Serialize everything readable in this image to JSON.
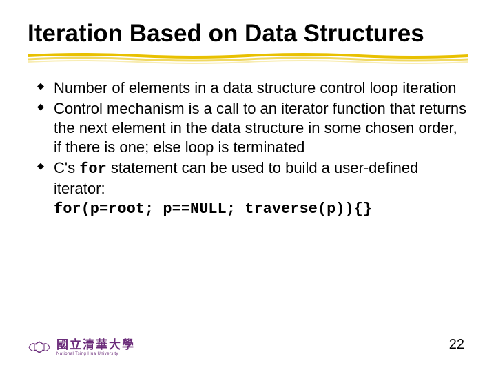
{
  "slide": {
    "title": "Iteration Based on Data Structures",
    "bullets": [
      {
        "text": "Number of elements in a data structure control loop iteration"
      },
      {
        "text": "Control mechanism is a call to an iterator function that returns the next element in the data structure in some chosen order, if there is one; else loop is terminated"
      },
      {
        "pre": "C's ",
        "code_inline": "for",
        "post": " statement can be used to build a user-defined iterator:",
        "code_block": "for(p=root; p==NULL; traverse(p)){}"
      }
    ],
    "page_number": "22",
    "logo": {
      "zh": "國立清華大學",
      "en": "National Tsing Hua University"
    }
  }
}
